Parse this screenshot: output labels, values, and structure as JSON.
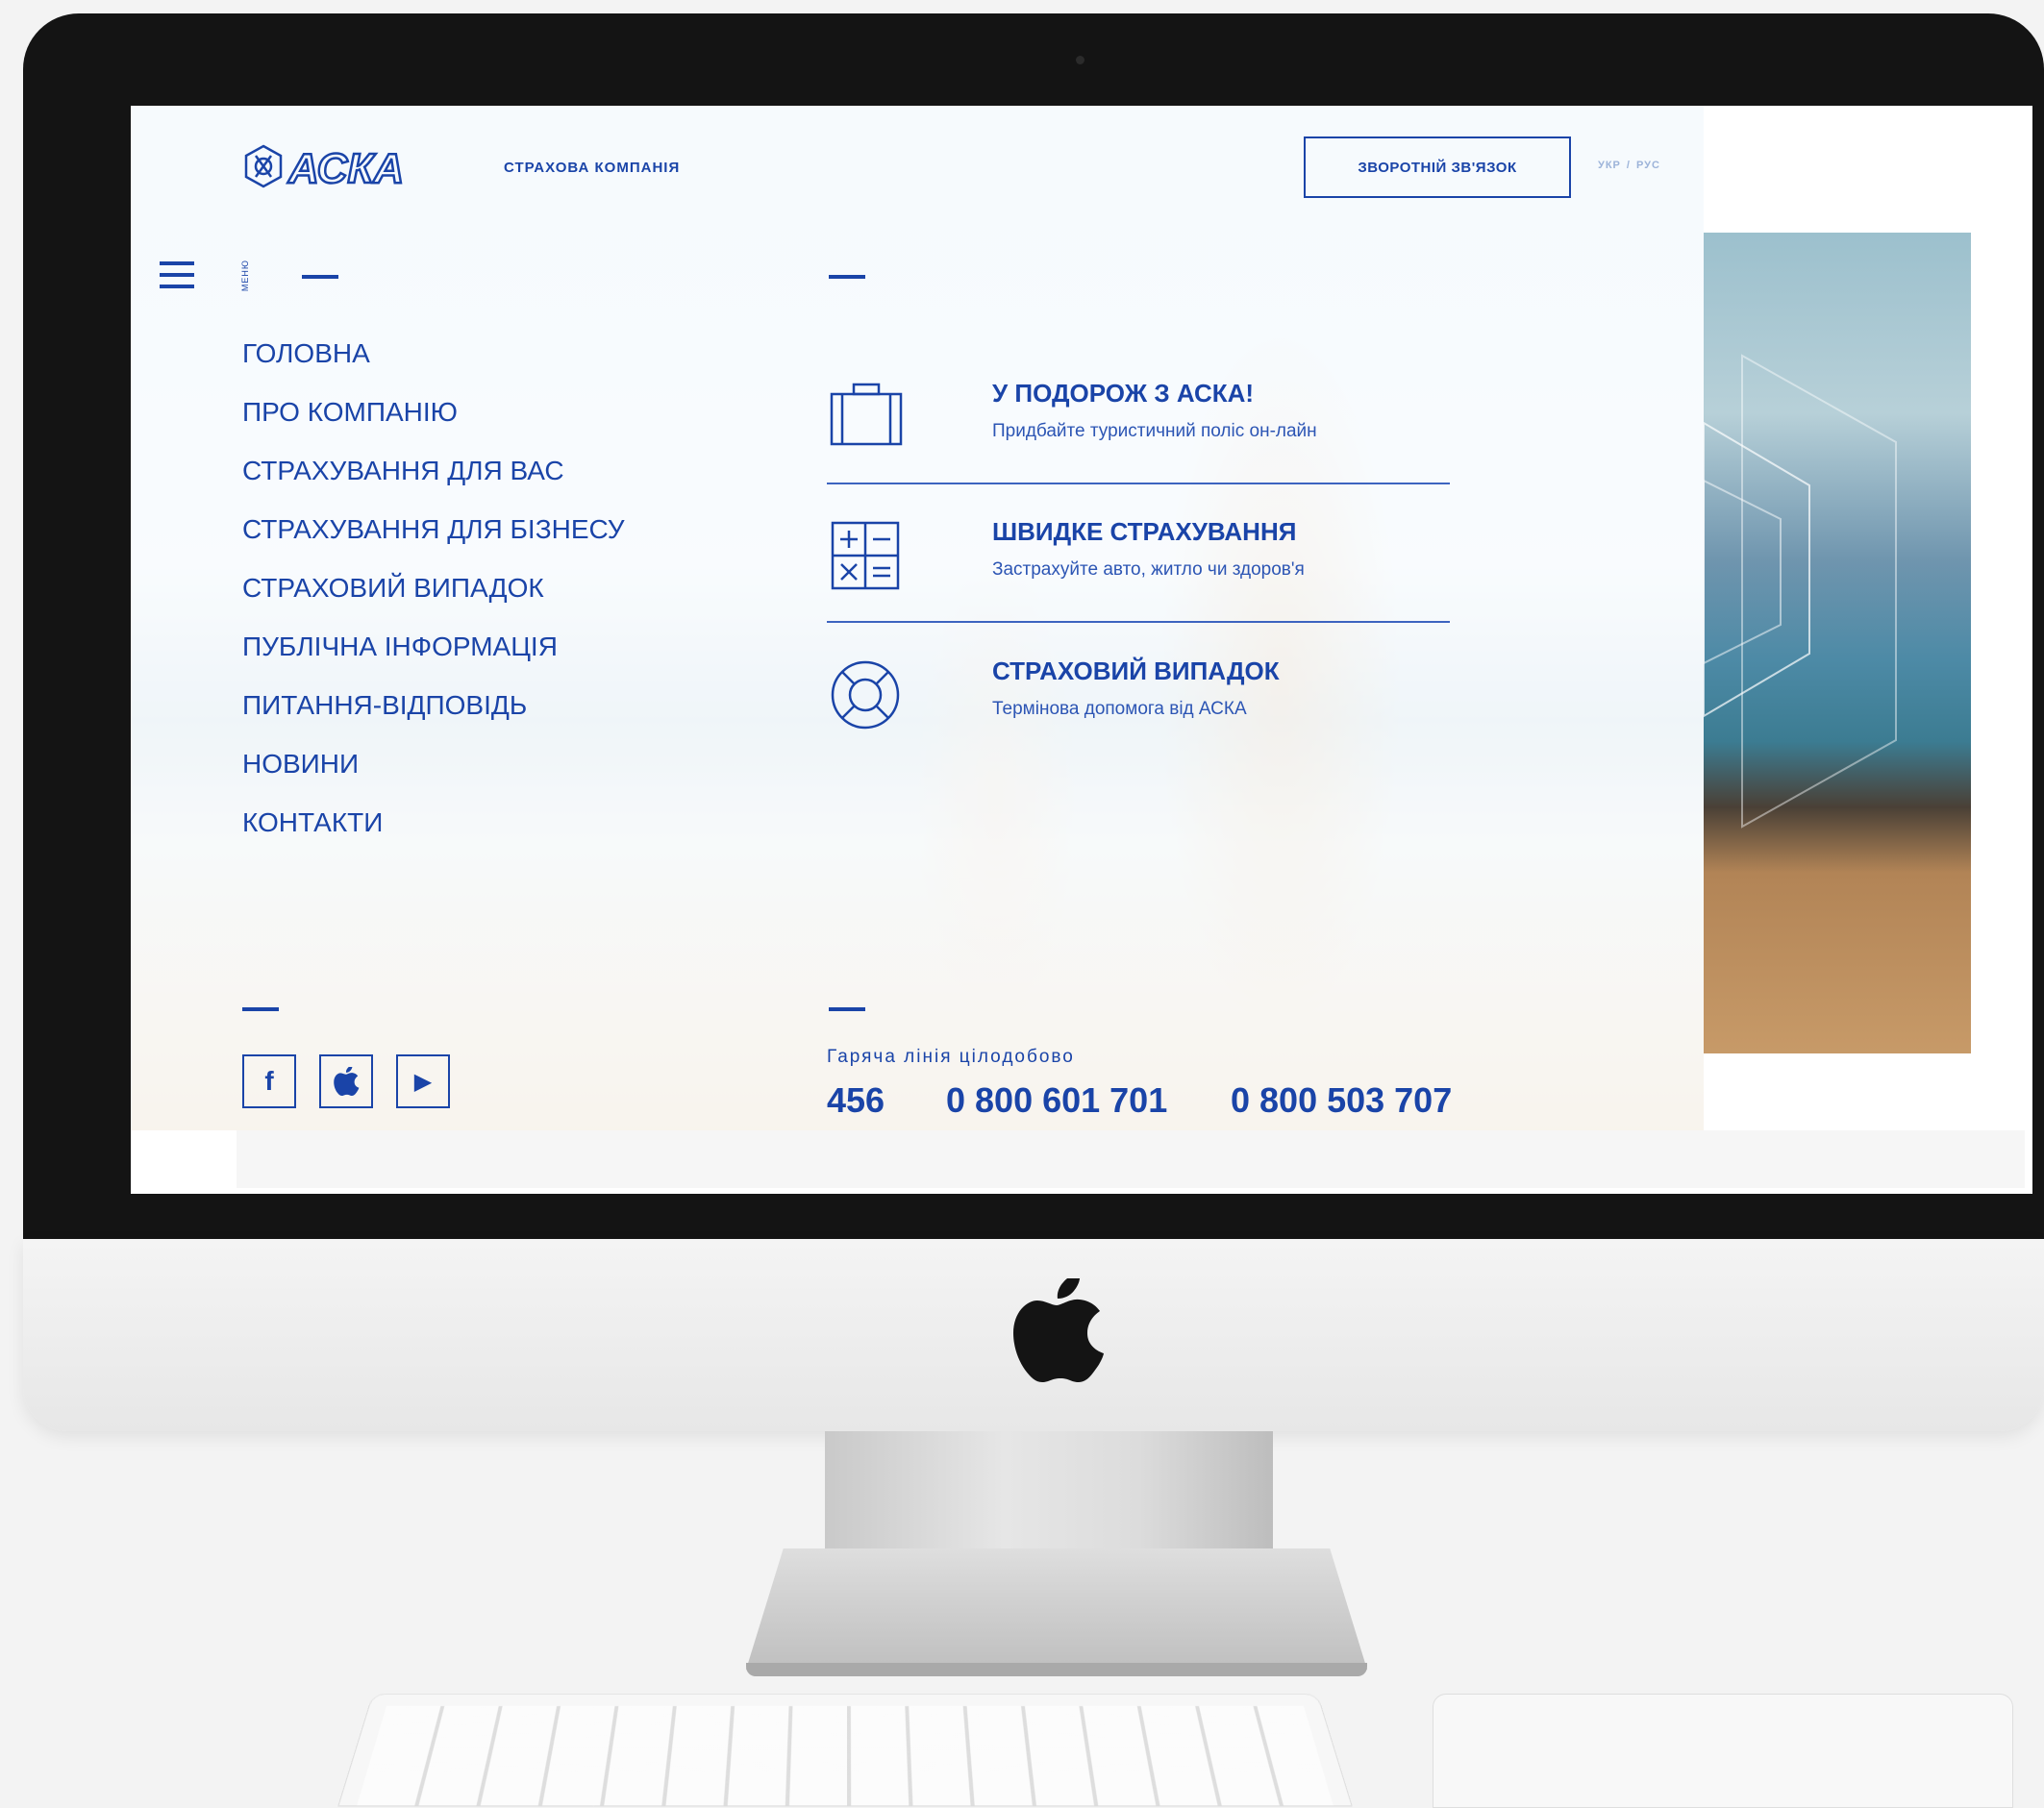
{
  "header": {
    "logo_text": "АСКА",
    "logo_subtitle": "СТРАХОВА КОМПАНІЯ",
    "feedback_label": "ЗВОРОТНІЙ ЗВ'ЯЗОК",
    "lang_ukr": "УКР",
    "lang_separator": "/",
    "lang_rus": "РУС"
  },
  "menu": {
    "vertical_label": "МЕНЮ",
    "items": [
      {
        "label": "ГОЛОВНА"
      },
      {
        "label": "ПРО КОМПАНІЮ"
      },
      {
        "label": "СТРАХУВАННЯ ДЛЯ ВАС"
      },
      {
        "label": "СТРАХУВАННЯ ДЛЯ БІЗНЕСУ"
      },
      {
        "label": "СТРАХОВИЙ ВИПАДОК"
      },
      {
        "label": "ПУБЛІЧНА ІНФОРМАЦІЯ"
      },
      {
        "label": "ПИТАННЯ-ВІДПОВІДЬ"
      },
      {
        "label": "НОВИНИ"
      },
      {
        "label": "КОНТАКТИ"
      }
    ]
  },
  "quick_links": [
    {
      "title": "У ПОДОРОЖ З АСКА!",
      "desc": "Придбайте туристичний поліс он-лайн",
      "icon": "suitcase-icon"
    },
    {
      "title": "ШВИДКЕ СТРАХУВАННЯ",
      "desc": "Застрахуйте авто, житло чи здоров'я",
      "icon": "calculator-icon"
    },
    {
      "title": "СТРАХОВИЙ ВИПАДОК",
      "desc": "Термінова допомога від АСКА",
      "icon": "lifebuoy-icon"
    }
  ],
  "social": [
    {
      "icon": "facebook-icon",
      "glyph": "f"
    },
    {
      "icon": "apple-icon"
    },
    {
      "icon": "play-icon",
      "glyph": "▶"
    }
  ],
  "hotline": {
    "label": "Гаряча лінія цілодобово",
    "phones": [
      "456",
      "0 800 601 701",
      "0 800 503 707"
    ]
  },
  "colors": {
    "brand_blue": "#1a44a8",
    "screen_bg": "#ffffff",
    "bezel": "#141414"
  }
}
